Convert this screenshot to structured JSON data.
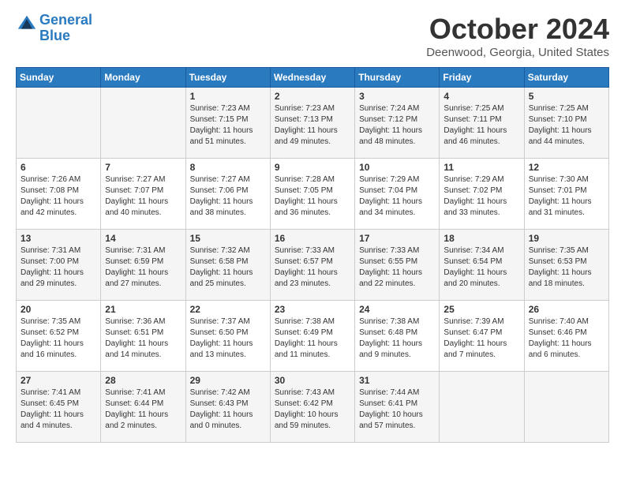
{
  "header": {
    "logo_line1": "General",
    "logo_line2": "Blue",
    "month": "October 2024",
    "location": "Deenwood, Georgia, United States"
  },
  "days_of_week": [
    "Sunday",
    "Monday",
    "Tuesday",
    "Wednesday",
    "Thursday",
    "Friday",
    "Saturday"
  ],
  "weeks": [
    [
      {
        "day": "",
        "sunrise": "",
        "sunset": "",
        "daylight": ""
      },
      {
        "day": "",
        "sunrise": "",
        "sunset": "",
        "daylight": ""
      },
      {
        "day": "1",
        "sunrise": "Sunrise: 7:23 AM",
        "sunset": "Sunset: 7:15 PM",
        "daylight": "Daylight: 11 hours and 51 minutes."
      },
      {
        "day": "2",
        "sunrise": "Sunrise: 7:23 AM",
        "sunset": "Sunset: 7:13 PM",
        "daylight": "Daylight: 11 hours and 49 minutes."
      },
      {
        "day": "3",
        "sunrise": "Sunrise: 7:24 AM",
        "sunset": "Sunset: 7:12 PM",
        "daylight": "Daylight: 11 hours and 48 minutes."
      },
      {
        "day": "4",
        "sunrise": "Sunrise: 7:25 AM",
        "sunset": "Sunset: 7:11 PM",
        "daylight": "Daylight: 11 hours and 46 minutes."
      },
      {
        "day": "5",
        "sunrise": "Sunrise: 7:25 AM",
        "sunset": "Sunset: 7:10 PM",
        "daylight": "Daylight: 11 hours and 44 minutes."
      }
    ],
    [
      {
        "day": "6",
        "sunrise": "Sunrise: 7:26 AM",
        "sunset": "Sunset: 7:08 PM",
        "daylight": "Daylight: 11 hours and 42 minutes."
      },
      {
        "day": "7",
        "sunrise": "Sunrise: 7:27 AM",
        "sunset": "Sunset: 7:07 PM",
        "daylight": "Daylight: 11 hours and 40 minutes."
      },
      {
        "day": "8",
        "sunrise": "Sunrise: 7:27 AM",
        "sunset": "Sunset: 7:06 PM",
        "daylight": "Daylight: 11 hours and 38 minutes."
      },
      {
        "day": "9",
        "sunrise": "Sunrise: 7:28 AM",
        "sunset": "Sunset: 7:05 PM",
        "daylight": "Daylight: 11 hours and 36 minutes."
      },
      {
        "day": "10",
        "sunrise": "Sunrise: 7:29 AM",
        "sunset": "Sunset: 7:04 PM",
        "daylight": "Daylight: 11 hours and 34 minutes."
      },
      {
        "day": "11",
        "sunrise": "Sunrise: 7:29 AM",
        "sunset": "Sunset: 7:02 PM",
        "daylight": "Daylight: 11 hours and 33 minutes."
      },
      {
        "day": "12",
        "sunrise": "Sunrise: 7:30 AM",
        "sunset": "Sunset: 7:01 PM",
        "daylight": "Daylight: 11 hours and 31 minutes."
      }
    ],
    [
      {
        "day": "13",
        "sunrise": "Sunrise: 7:31 AM",
        "sunset": "Sunset: 7:00 PM",
        "daylight": "Daylight: 11 hours and 29 minutes."
      },
      {
        "day": "14",
        "sunrise": "Sunrise: 7:31 AM",
        "sunset": "Sunset: 6:59 PM",
        "daylight": "Daylight: 11 hours and 27 minutes."
      },
      {
        "day": "15",
        "sunrise": "Sunrise: 7:32 AM",
        "sunset": "Sunset: 6:58 PM",
        "daylight": "Daylight: 11 hours and 25 minutes."
      },
      {
        "day": "16",
        "sunrise": "Sunrise: 7:33 AM",
        "sunset": "Sunset: 6:57 PM",
        "daylight": "Daylight: 11 hours and 23 minutes."
      },
      {
        "day": "17",
        "sunrise": "Sunrise: 7:33 AM",
        "sunset": "Sunset: 6:55 PM",
        "daylight": "Daylight: 11 hours and 22 minutes."
      },
      {
        "day": "18",
        "sunrise": "Sunrise: 7:34 AM",
        "sunset": "Sunset: 6:54 PM",
        "daylight": "Daylight: 11 hours and 20 minutes."
      },
      {
        "day": "19",
        "sunrise": "Sunrise: 7:35 AM",
        "sunset": "Sunset: 6:53 PM",
        "daylight": "Daylight: 11 hours and 18 minutes."
      }
    ],
    [
      {
        "day": "20",
        "sunrise": "Sunrise: 7:35 AM",
        "sunset": "Sunset: 6:52 PM",
        "daylight": "Daylight: 11 hours and 16 minutes."
      },
      {
        "day": "21",
        "sunrise": "Sunrise: 7:36 AM",
        "sunset": "Sunset: 6:51 PM",
        "daylight": "Daylight: 11 hours and 14 minutes."
      },
      {
        "day": "22",
        "sunrise": "Sunrise: 7:37 AM",
        "sunset": "Sunset: 6:50 PM",
        "daylight": "Daylight: 11 hours and 13 minutes."
      },
      {
        "day": "23",
        "sunrise": "Sunrise: 7:38 AM",
        "sunset": "Sunset: 6:49 PM",
        "daylight": "Daylight: 11 hours and 11 minutes."
      },
      {
        "day": "24",
        "sunrise": "Sunrise: 7:38 AM",
        "sunset": "Sunset: 6:48 PM",
        "daylight": "Daylight: 11 hours and 9 minutes."
      },
      {
        "day": "25",
        "sunrise": "Sunrise: 7:39 AM",
        "sunset": "Sunset: 6:47 PM",
        "daylight": "Daylight: 11 hours and 7 minutes."
      },
      {
        "day": "26",
        "sunrise": "Sunrise: 7:40 AM",
        "sunset": "Sunset: 6:46 PM",
        "daylight": "Daylight: 11 hours and 6 minutes."
      }
    ],
    [
      {
        "day": "27",
        "sunrise": "Sunrise: 7:41 AM",
        "sunset": "Sunset: 6:45 PM",
        "daylight": "Daylight: 11 hours and 4 minutes."
      },
      {
        "day": "28",
        "sunrise": "Sunrise: 7:41 AM",
        "sunset": "Sunset: 6:44 PM",
        "daylight": "Daylight: 11 hours and 2 minutes."
      },
      {
        "day": "29",
        "sunrise": "Sunrise: 7:42 AM",
        "sunset": "Sunset: 6:43 PM",
        "daylight": "Daylight: 11 hours and 0 minutes."
      },
      {
        "day": "30",
        "sunrise": "Sunrise: 7:43 AM",
        "sunset": "Sunset: 6:42 PM",
        "daylight": "Daylight: 10 hours and 59 minutes."
      },
      {
        "day": "31",
        "sunrise": "Sunrise: 7:44 AM",
        "sunset": "Sunset: 6:41 PM",
        "daylight": "Daylight: 10 hours and 57 minutes."
      },
      {
        "day": "",
        "sunrise": "",
        "sunset": "",
        "daylight": ""
      },
      {
        "day": "",
        "sunrise": "",
        "sunset": "",
        "daylight": ""
      }
    ]
  ]
}
